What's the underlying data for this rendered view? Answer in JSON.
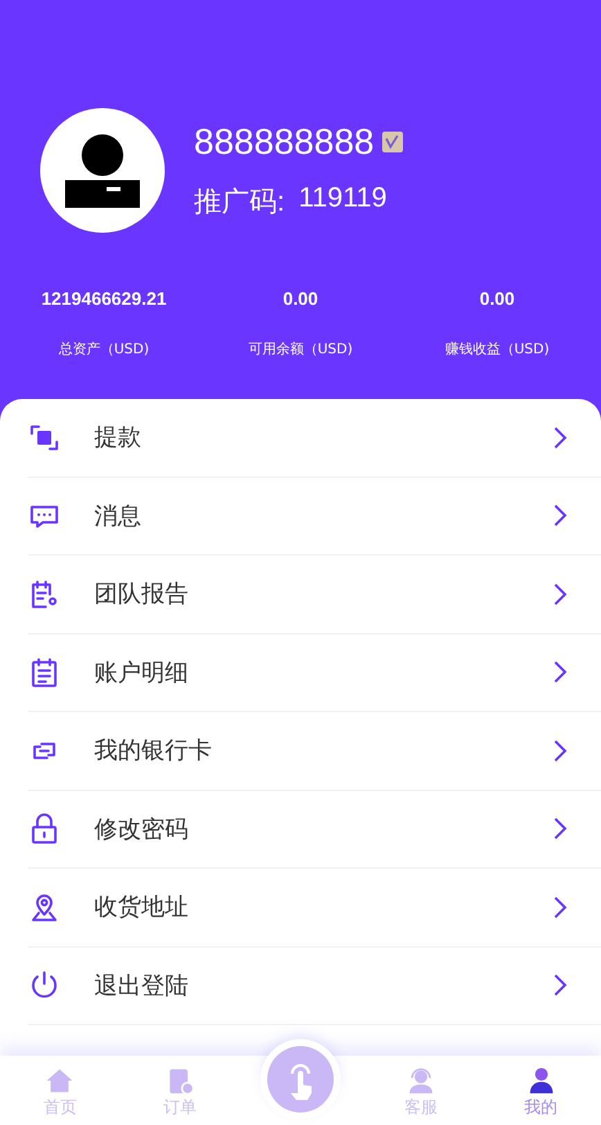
{
  "profile": {
    "username": "888888888",
    "promo_label": "推广码:",
    "promo_code": "119119"
  },
  "stats": [
    {
      "value": "1219466629.21",
      "label": "总资产（USD)"
    },
    {
      "value": "0.00",
      "label": "可用余额（USD)"
    },
    {
      "value": "0.00",
      "label": "赚钱收益（USD)"
    }
  ],
  "menu": [
    {
      "label": "提款"
    },
    {
      "label": "消息"
    },
    {
      "label": "团队报告"
    },
    {
      "label": "账户明细"
    },
    {
      "label": "我的银行卡"
    },
    {
      "label": "修改密码"
    },
    {
      "label": "收货地址"
    },
    {
      "label": "退出登陆"
    }
  ],
  "nav": [
    {
      "label": "首页",
      "selected": false
    },
    {
      "label": "订单",
      "selected": false
    },
    {
      "kind": "center"
    },
    {
      "label": "客服",
      "selected": false
    },
    {
      "label": "我的",
      "selected": true
    }
  ]
}
